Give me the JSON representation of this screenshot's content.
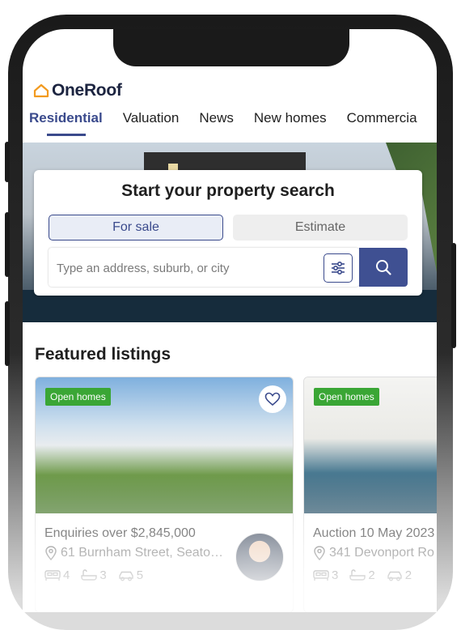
{
  "app": {
    "logo_text": "OneRoof",
    "accent_color": "#3a4a8c",
    "logo_color": "#f29a1f"
  },
  "tabs": [
    {
      "label": "Residential",
      "active": true
    },
    {
      "label": "Valuation"
    },
    {
      "label": "News"
    },
    {
      "label": "New homes"
    },
    {
      "label": "Commercia"
    }
  ],
  "search": {
    "title": "Start your property search",
    "mode_for_sale": "For sale",
    "mode_estimate": "Estimate",
    "placeholder": "Type an address, suburb, or city",
    "filter_icon": "sliders-icon",
    "search_icon": "search-icon"
  },
  "featured": {
    "title": "Featured listings",
    "listings": [
      {
        "badge": "Open homes",
        "title": "Enquiries over $2,845,000",
        "address": "61 Burnham Street, Seato…",
        "beds": "4",
        "baths": "3",
        "cars": "5"
      },
      {
        "badge": "Open homes",
        "title": "Auction 10 May 2023",
        "address": "341 Devonport Ro",
        "beds": "3",
        "baths": "2",
        "cars": "2"
      }
    ]
  }
}
